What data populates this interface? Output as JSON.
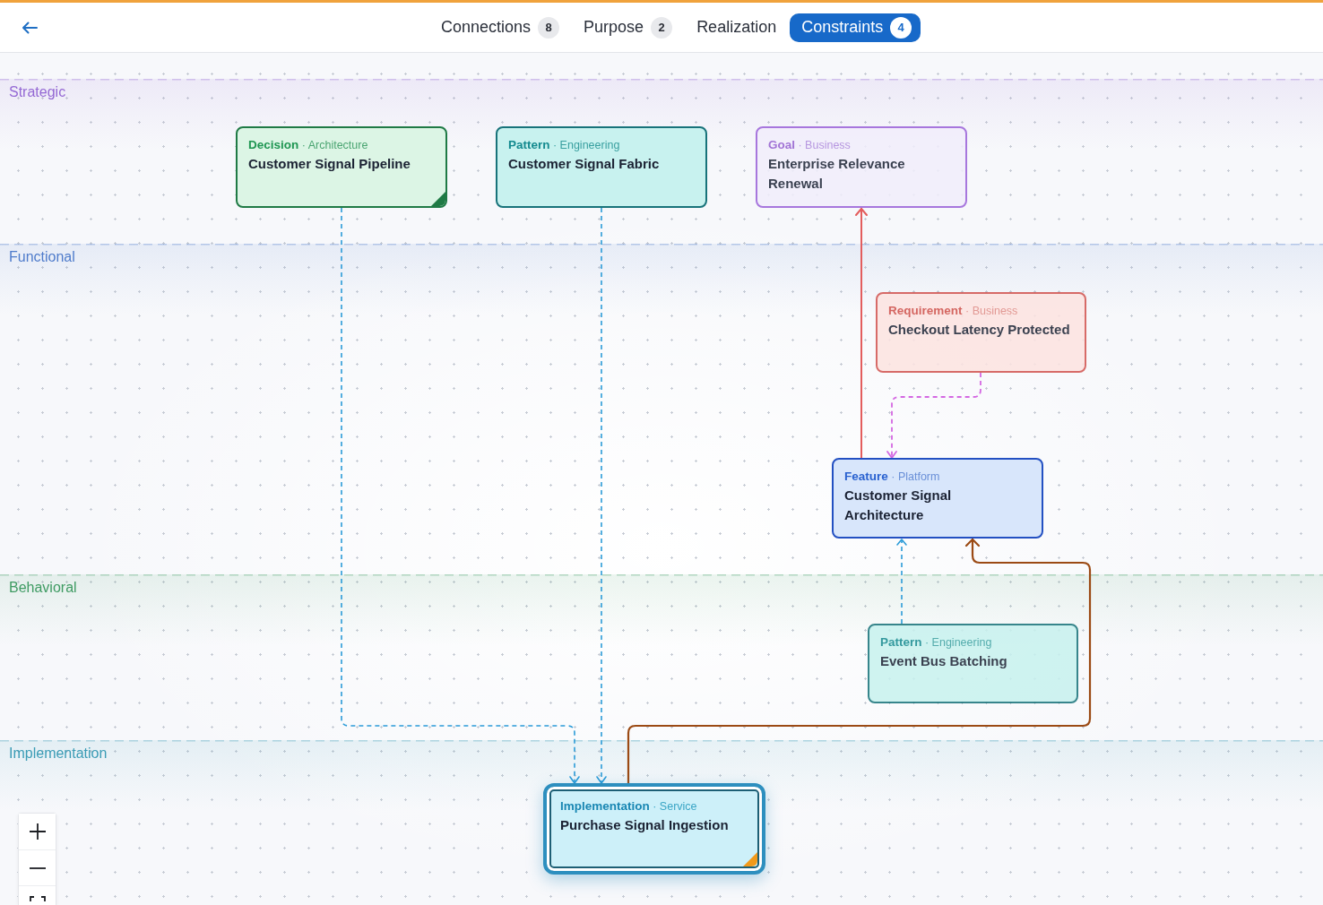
{
  "tabs": [
    {
      "label": "Connections",
      "count": "8",
      "selected": false
    },
    {
      "label": "Purpose",
      "count": "2",
      "selected": false
    },
    {
      "label": "Realization",
      "selected": false
    },
    {
      "label": "Constraints",
      "count": "4",
      "selected": true
    }
  ],
  "lanes": [
    {
      "label": "Strategic",
      "color": "#9468d4",
      "nodes": [
        {
          "kind": "decision",
          "header": "**Decision** · Architecture",
          "title": "Customer Signal Pipeline",
          "selected": false,
          "dimmed": false,
          "flag": {
            "color": "#1f7a45"
          }
        },
        {
          "kind": "pattern",
          "header": "**Pattern** · Engineering",
          "title": "Customer Signal Fabric",
          "selected": false,
          "dimmed": false
        },
        {
          "kind": "goal",
          "header": "**Goal** · Business",
          "title": "Enterprise Relevance Renewal",
          "selected": false,
          "dimmed": true
        }
      ]
    },
    {
      "label": "Functional",
      "color": "#4f7ccb",
      "nodes": [
        {
          "kind": "requirement",
          "header": "**Requirement** · Business",
          "title": "Checkout Latency Protected",
          "selected": false,
          "dimmed": true
        },
        {
          "kind": "feature",
          "header": "**Feature** · Platform",
          "title": "Customer Signal Architecture",
          "selected": false,
          "dimmed": false
        }
      ]
    },
    {
      "label": "Behavioral",
      "color": "#3f9b63",
      "nodes": [
        {
          "kind": "pattern",
          "header": "**Pattern** · Engineering",
          "title": "Event Bus Batching",
          "selected": false,
          "dimmed": true
        }
      ]
    },
    {
      "label": "Implementation",
      "color": "#3a9bb5",
      "nodes": [
        {
          "kind": "implementation",
          "header": "**Implementation** · Service",
          "title": "Purchase Signal Ingestion",
          "selected": true,
          "dimmed": false,
          "flag": {
            "color": "#f29a1a"
          }
        }
      ]
    }
  ]
}
